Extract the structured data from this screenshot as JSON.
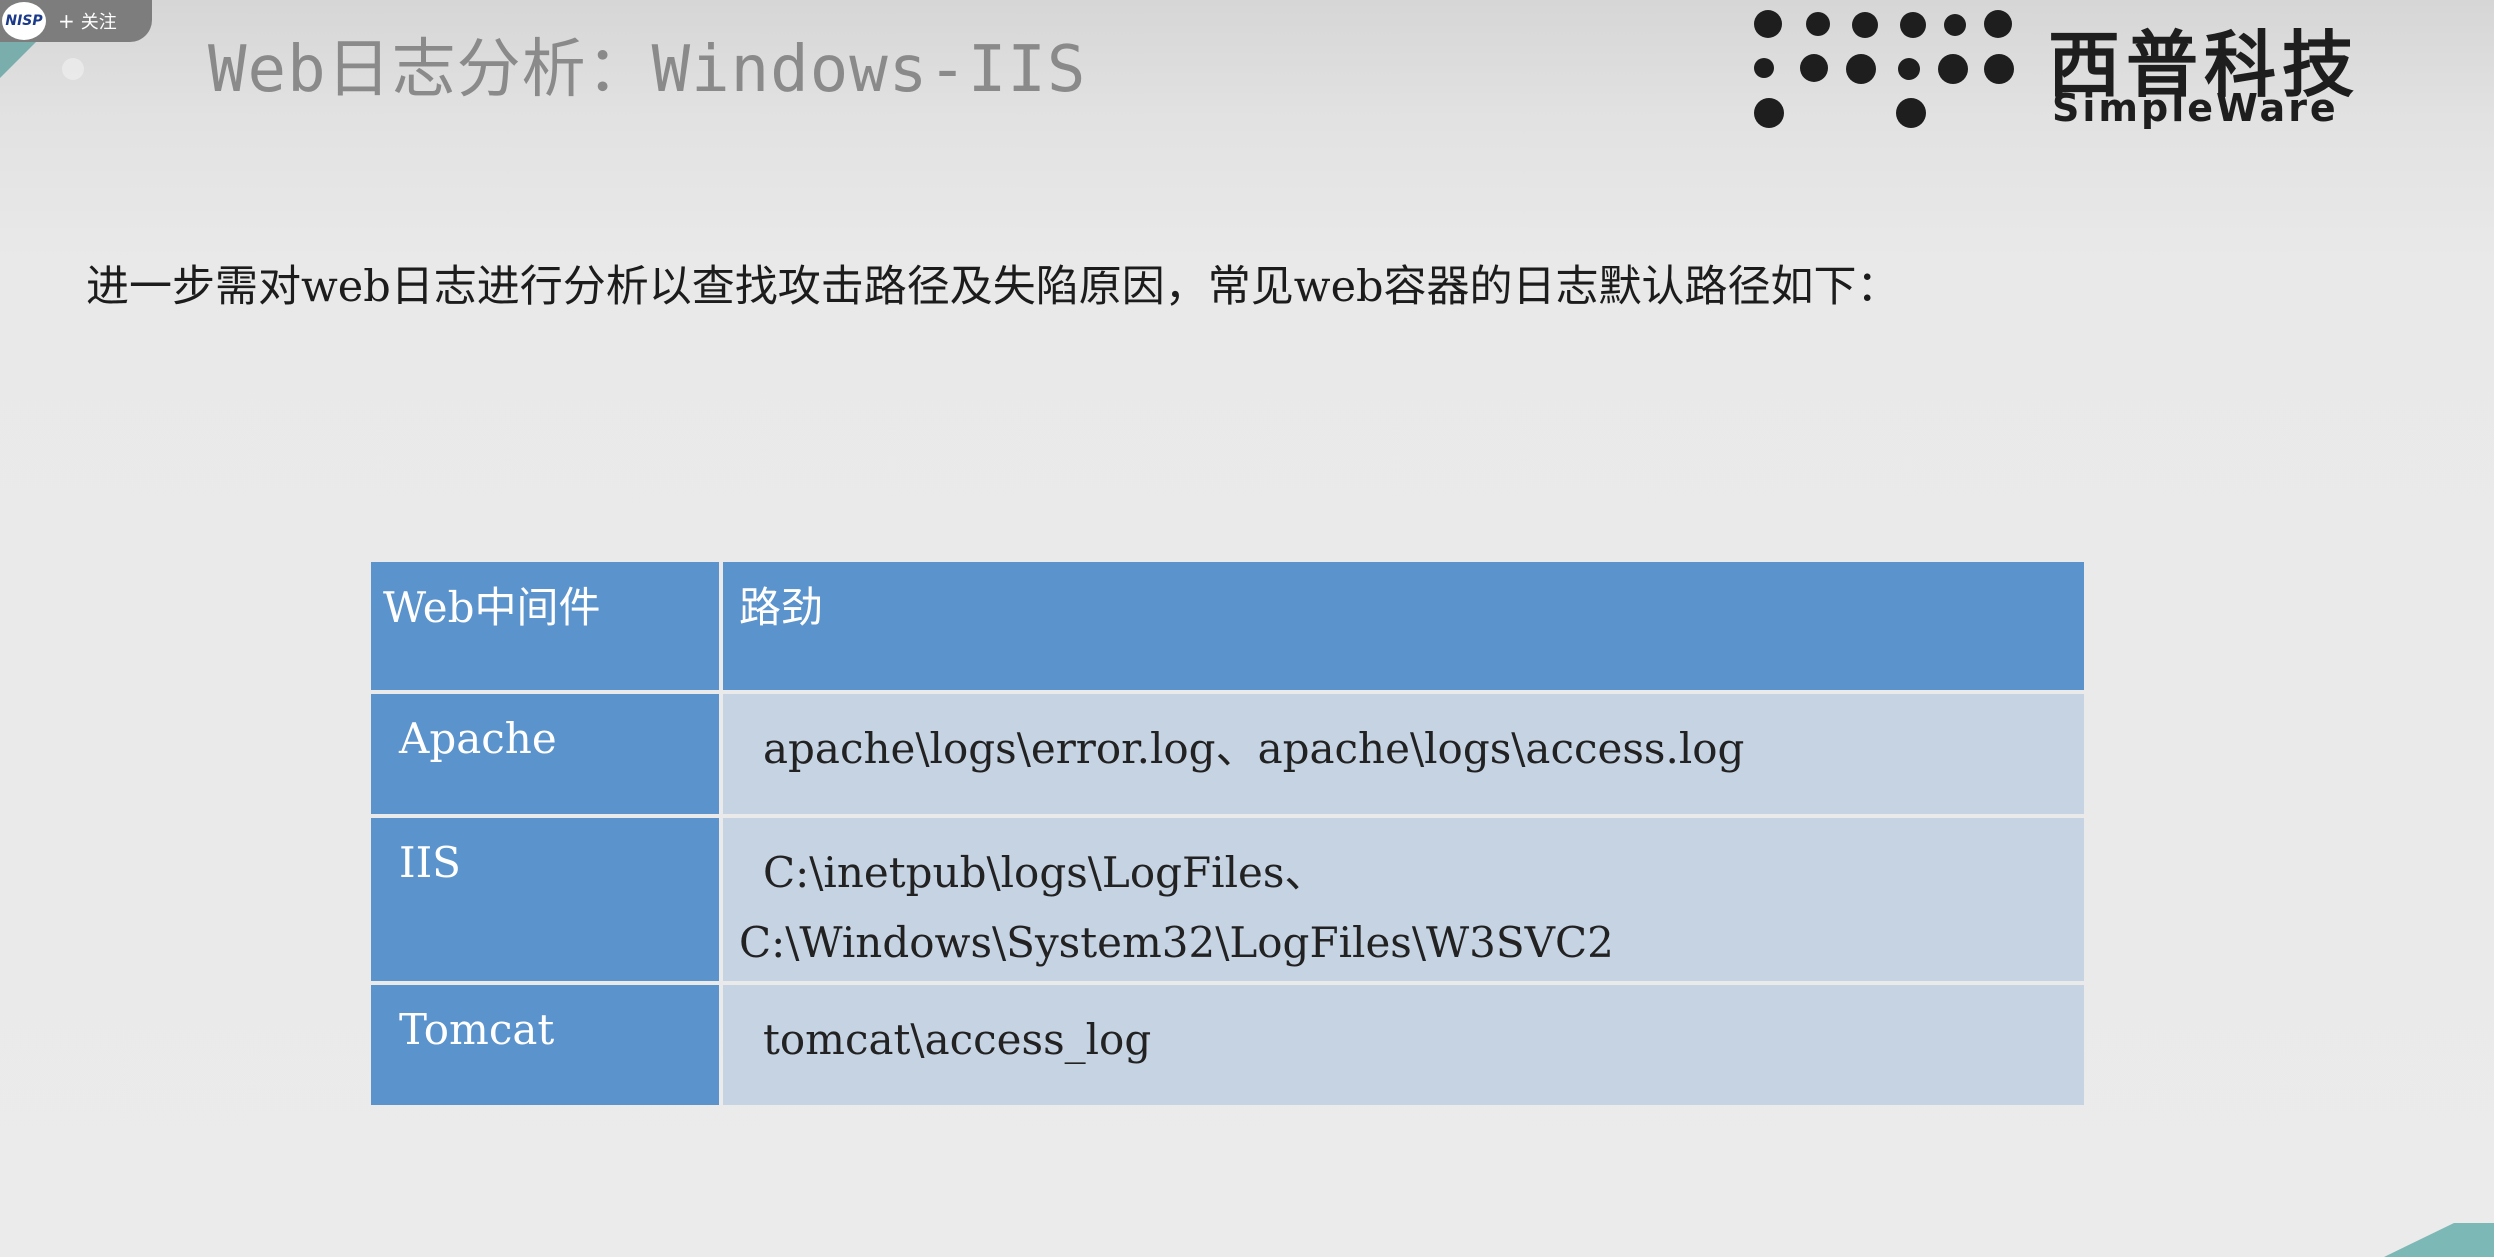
{
  "overlay": {
    "logo_text": "NISP",
    "plus": "+",
    "follow_label": "关注"
  },
  "slide": {
    "title": "Web日志分析：Windows-IIS",
    "intro": "进一步需对web日志进行分析以查找攻击路径及失陷原因，常见web容器的日志默认路径如下："
  },
  "brand": {
    "name_cn": "西普科技",
    "name_en": "SimpleWare"
  },
  "table": {
    "headers": [
      "Web中间件",
      "路劲"
    ],
    "rows": [
      {
        "middleware": "Apache",
        "path_lines": [
          "apache\\logs\\error.log、apache\\logs\\access.log"
        ]
      },
      {
        "middleware": "IIS",
        "path_lines": [
          "C:\\inetpub\\logs\\LogFiles、",
          "C:\\Windows\\System32\\LogFiles\\W3SVC2"
        ]
      },
      {
        "middleware": "Tomcat",
        "path_lines": [
          "tomcat\\access_log"
        ]
      }
    ]
  },
  "colors": {
    "header_bg": "#5b93cd",
    "cell_bg": "#c6d3e3",
    "accent_teal": "#7cb8b5"
  }
}
